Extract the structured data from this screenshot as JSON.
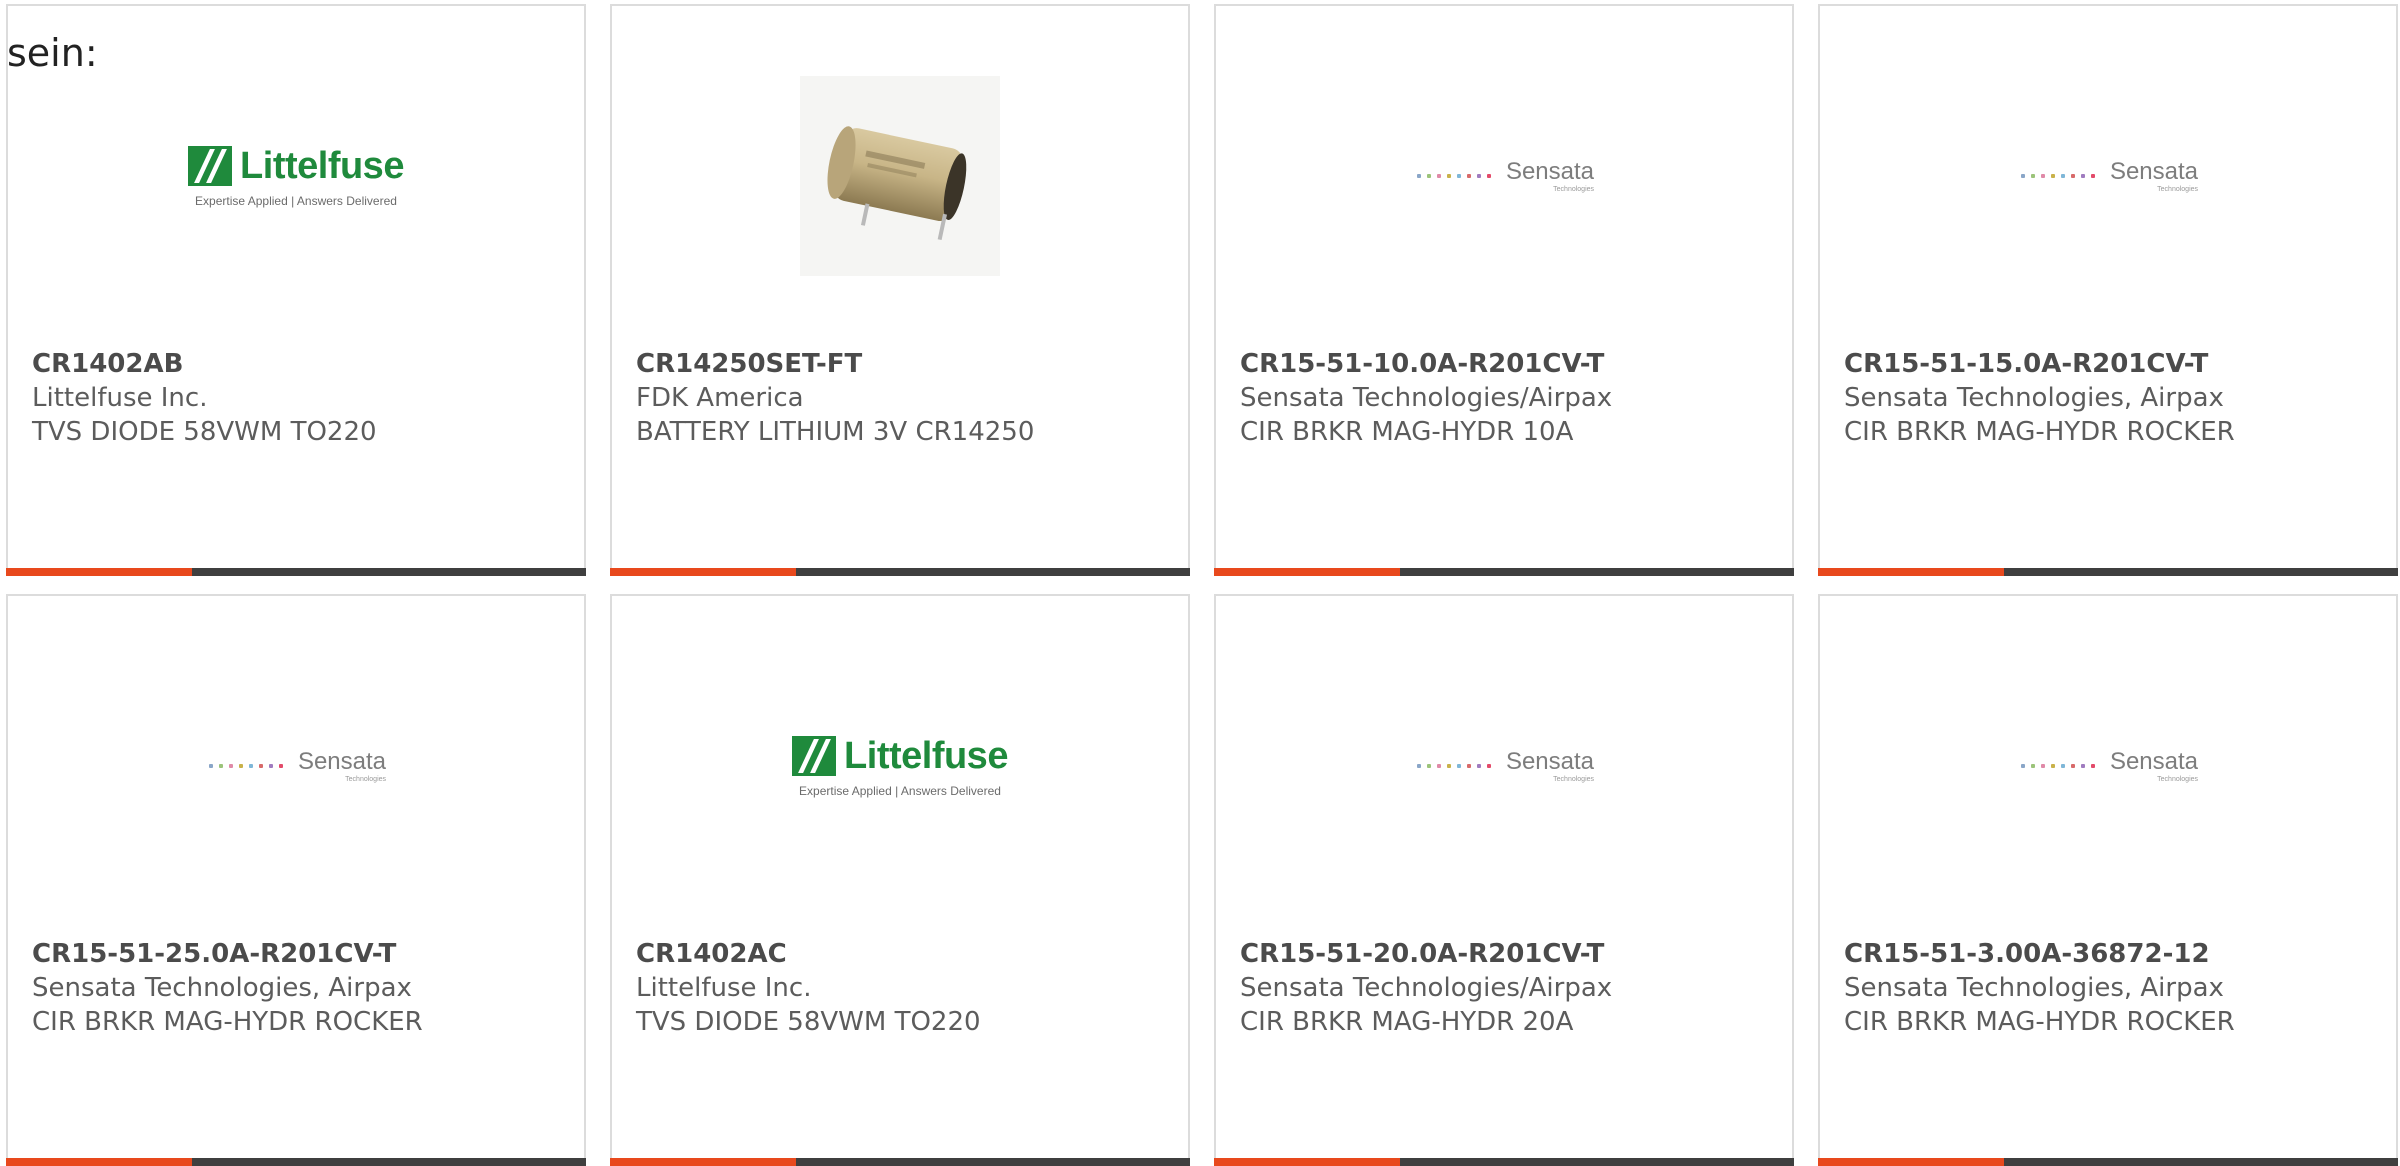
{
  "lead_text": "sein:",
  "colors": {
    "accent": "#e8491d",
    "bar": "#3f3f3f",
    "littelfuse_green": "#1f8a3c",
    "border": "#dcdcdc"
  },
  "logos": {
    "littelfuse": {
      "name": "Littelfuse",
      "tagline": "Expertise Applied | Answers Delivered"
    },
    "sensata": {
      "name": "Sensata",
      "sub": "Technologies"
    }
  },
  "products": [
    {
      "part_number": "CR1402AB",
      "manufacturer": "Littelfuse Inc.",
      "description": "TVS DIODE 58VWM TO220",
      "image": "littelfuse-logo"
    },
    {
      "part_number": "CR14250SET-FT",
      "manufacturer": "FDK America",
      "description": "BATTERY LITHIUM 3V CR14250",
      "image": "battery-photo"
    },
    {
      "part_number": "CR15-51-10.0A-R201CV-T",
      "manufacturer": "Sensata Technologies/Airpax",
      "description": "CIR BRKR MAG-HYDR 10A",
      "image": "sensata-logo"
    },
    {
      "part_number": "CR15-51-15.0A-R201CV-T",
      "manufacturer": "Sensata Technologies, Airpax",
      "description": "CIR BRKR MAG-HYDR ROCKER",
      "image": "sensata-logo"
    },
    {
      "part_number": "CR15-51-25.0A-R201CV-T",
      "manufacturer": "Sensata Technologies, Airpax",
      "description": "CIR BRKR MAG-HYDR ROCKER",
      "image": "sensata-logo"
    },
    {
      "part_number": "CR1402AC",
      "manufacturer": "Littelfuse Inc.",
      "description": "TVS DIODE 58VWM TO220",
      "image": "littelfuse-logo"
    },
    {
      "part_number": "CR15-51-20.0A-R201CV-T",
      "manufacturer": "Sensata Technologies/Airpax",
      "description": "CIR BRKR MAG-HYDR 20A",
      "image": "sensata-logo"
    },
    {
      "part_number": "CR15-51-3.00A-36872-12",
      "manufacturer": "Sensata Technologies, Airpax",
      "description": "CIR BRKR MAG-HYDR ROCKER",
      "image": "sensata-logo"
    }
  ]
}
